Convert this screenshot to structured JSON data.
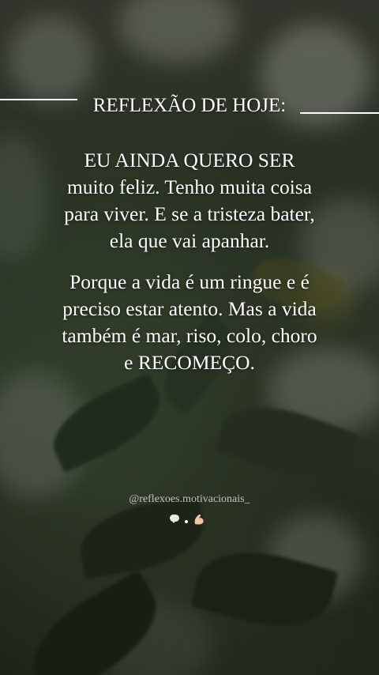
{
  "heading": {
    "title": "REFLEXÃO DE HOJE:"
  },
  "paragraph_1": {
    "lines": [
      "EU AINDA QUERO SER",
      "muito feliz. Tenho muita coisa",
      "para viver. E se a tristeza bater,",
      "ela que vai apanhar."
    ]
  },
  "paragraph_2": {
    "lines": [
      "Porque a vida é um ringue e é",
      "preciso estar atento. Mas a vida",
      "também é mar, riso, colo, choro",
      "e RECOMEÇO."
    ]
  },
  "signature": {
    "handle": "@reflexoes.motivacionais_"
  },
  "icons": {
    "speech": "speech-bubble-icon",
    "dot": "dot-icon",
    "arm": "flexed-biceps-icon"
  },
  "colors": {
    "text": "#ffffff",
    "background": "#2f3a2a",
    "handle": "#e1e1e1"
  }
}
